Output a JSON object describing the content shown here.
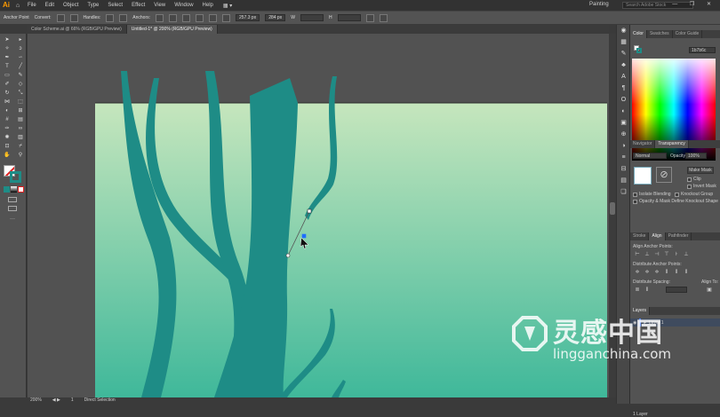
{
  "app": {
    "logo_text": "Ai",
    "workspace": "Painting",
    "search_placeholder": "Search Adobe Stock",
    "window_controls": "— ❐ ✕"
  },
  "menubar": {
    "items": [
      "File",
      "Edit",
      "Object",
      "Type",
      "Select",
      "Effect",
      "View",
      "Window",
      "Help"
    ]
  },
  "controlbar": {
    "anchor_label": "Anchor Point",
    "convert_label": "Convert:",
    "handles_label": "Handles:",
    "anchors_label": "Anchors:",
    "x_value": "257.3 px",
    "y_value": "284 px",
    "w_label": "W",
    "h_label": "H"
  },
  "tabs": [
    {
      "label": "Color Scheme.ai @ 66% (RGB/GPU Preview)",
      "active": false
    },
    {
      "label": "Untitled-1* @ 200% (RGB/GPU Preview)",
      "active": true
    }
  ],
  "statusbar": {
    "zoom": "200%",
    "page": "1",
    "mode": "Direct Selection",
    "arrows": "◀ ▶"
  },
  "color_panel": {
    "tabs": [
      "Color",
      "Swatches",
      "Color Guide"
    ],
    "hex": "1b7b6c"
  },
  "transparency_panel": {
    "tabs": [
      "Navigator",
      "Transparency"
    ],
    "blend_mode": "Normal",
    "opacity_label": "Opacity:",
    "opacity": "100%",
    "make_mask": "Make Mask",
    "clip": "Clip",
    "invert_mask": "Invert Mask",
    "isolate_blending": "Isolate Blending",
    "knockout_group": "Knockout Group",
    "opacity_mask_label": "Opacity & Mask Define Knockout Shape"
  },
  "align_panel": {
    "tabs": [
      "Stroke",
      "Align",
      "Pathfinder"
    ],
    "align_anchor_label": "Align Anchor Points:",
    "distribute_anchor_label": "Distribute Anchor Points:",
    "distribute_spacing_label": "Distribute Spacing:",
    "align_to_label": "Align To:"
  },
  "layers_panel": {
    "tab": "Layers",
    "layer_name": "Layer 1",
    "status": "1 Layer"
  },
  "watermark": {
    "cn": "灵感中国",
    "en": "lingganchina.com"
  },
  "colors": {
    "teal": "#1e8c86",
    "bg_top": "#c6e6bd",
    "bg_bottom": "#3fb89a",
    "pasteboard": "#525252"
  }
}
